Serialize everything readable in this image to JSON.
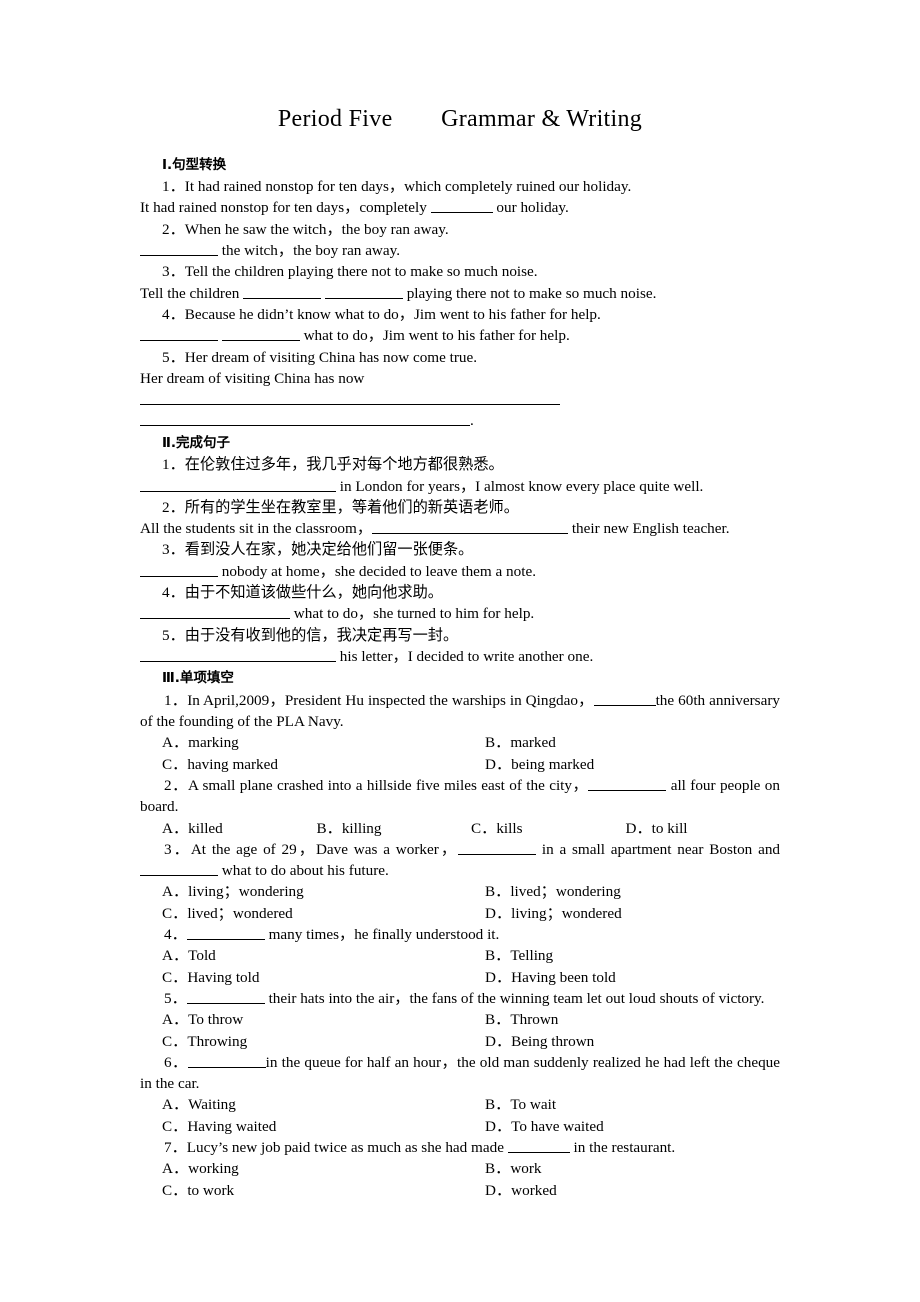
{
  "title": "Period Five　　Grammar & Writing",
  "sections": {
    "one": {
      "heading": "Ⅰ.句型转换",
      "items": [
        {
          "q": "1．It had rained nonstop for ten days，which completely ruined our holiday.",
          "a_pre": "It had rained nonstop for ten days，completely ",
          "a_post": " our holiday."
        },
        {
          "q": "2．When he saw the witch，the boy ran away.",
          "a_pre": "",
          "a_post": " the witch，the boy ran away."
        },
        {
          "q": "3．Tell the children playing there not to make so much noise.",
          "a_pre": "Tell the children ",
          "a_mid": " ",
          "a_post": " playing there not to make so much noise."
        },
        {
          "q": "4．Because he didn’t know what to do，Jim went to his father for help.",
          "a_pre": "",
          "a_mid": " ",
          "a_post": " what to do，Jim went to his father for help."
        },
        {
          "q": "5．Her dream of visiting China has now come true.",
          "a_pre": "Her dream of visiting China has now ",
          "a_post": "."
        }
      ]
    },
    "two": {
      "heading": "Ⅱ.完成句子",
      "items": [
        {
          "cn": "1．在伦敦住过多年，我几乎对每个地方都很熟悉。",
          "en_pre": "",
          "en_post": " in London for years，I almost know every place quite well."
        },
        {
          "cn": "2．所有的学生坐在教室里，等着他们的新英语老师。",
          "en_pre": "All the students sit in the classroom，",
          "en_post": " their new English teacher."
        },
        {
          "cn": "3．看到没人在家，她决定给他们留一张便条。",
          "en_pre": "",
          "en_post": " nobody at home，she decided to leave them a note."
        },
        {
          "cn": "4．由于不知道该做些什么，她向他求助。",
          "en_pre": "",
          "en_post": " what to do，she turned to him for help."
        },
        {
          "cn": "5．由于没有收到他的信，我决定再写一封。",
          "en_pre": "",
          "en_post": " his letter，I decided to write another one."
        }
      ]
    },
    "three": {
      "heading": "Ⅲ.单项填空",
      "items": [
        {
          "stem_pre": "1．In April,2009，President Hu inspected the warships in Qingdao，",
          "stem_post": "the 60th anniversary of the founding of the PLA Navy.",
          "layout": "two",
          "options": [
            "A．marking",
            "B．marked",
            "C．having marked",
            "D．being marked"
          ]
        },
        {
          "stem_pre": "2．A small plane crashed into a hillside five miles east of the city，",
          "stem_post": " all four people on board.",
          "layout": "four",
          "options": [
            "A．killed",
            "B．killing",
            "C．kills",
            "D．to kill"
          ]
        },
        {
          "stem_pre": "3．At the age of 29，Dave was a worker，",
          "stem_mid": " in a small apartment near Boston and ",
          "stem_post": " what to do about his future.",
          "layout": "two",
          "options": [
            "A．living；wondering",
            "B．lived；wondering",
            "C．lived；wondered",
            "D．living；wondered"
          ]
        },
        {
          "stem_pre": "4．",
          "stem_post": " many times，he finally understood it.",
          "layout": "two",
          "options": [
            "A．Told",
            "B．Telling",
            "C．Having told",
            "D．Having been told"
          ]
        },
        {
          "stem_pre": "5．",
          "stem_post": " their hats into the air，the fans of the winning team let out loud shouts of victory.",
          "layout": "two",
          "options": [
            "A．To throw",
            "B．Thrown",
            "C．Throwing",
            "D．Being thrown"
          ]
        },
        {
          "stem_pre": "6．",
          "stem_post": "in the queue for half an hour，the old man suddenly realized he had left the cheque in the car.",
          "layout": "two",
          "options": [
            "A．Waiting",
            "B．To wait",
            "C．Having waited",
            "D．To have waited"
          ]
        },
        {
          "stem_pre": "7．Lucy’s new job paid twice as much as she had made ",
          "stem_post": " in the restaurant.",
          "layout": "two",
          "options": [
            "A．working",
            "B．work",
            "C．to work",
            "D．worked"
          ]
        }
      ]
    }
  }
}
